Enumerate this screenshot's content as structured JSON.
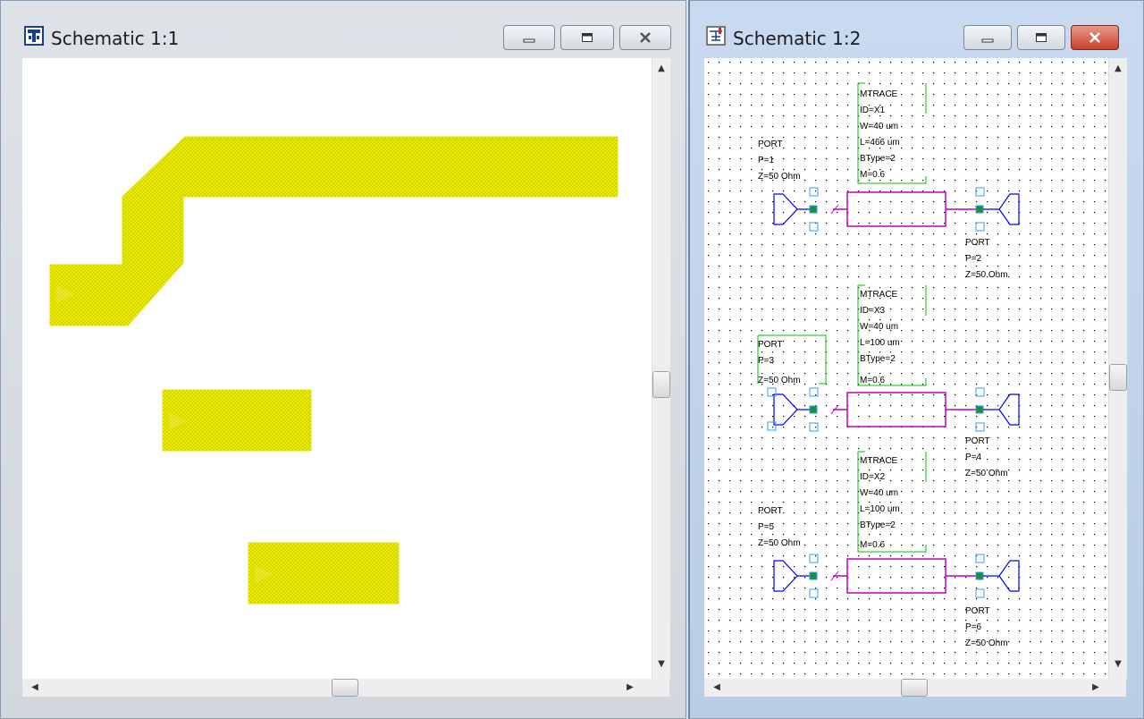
{
  "windows": [
    {
      "title": "Schematic 1:1",
      "icon": "schematic-layout-icon",
      "buttons": [
        "minimize",
        "maximize",
        "close"
      ]
    },
    {
      "title": "Schematic 1:2",
      "icon": "schematic-diagram-icon",
      "buttons": [
        "minimize",
        "maximize",
        "close"
      ],
      "components": {
        "mtrace1": {
          "name": "MTRACE",
          "id": "ID=X1",
          "w": "W=40 um",
          "l": "L=466 um",
          "btype": "BType=2",
          "m": "M=0.6"
        },
        "mtrace3": {
          "name": "MTRACE",
          "id": "ID=X3",
          "w": "W=40 um",
          "l": "L=100 um",
          "btype": "BType=2",
          "m": "M=0.6"
        },
        "mtrace2": {
          "name": "MTRACE",
          "id": "ID=X2",
          "w": "W=40 um",
          "l": "L=100 um",
          "btype": "BType=2",
          "m": "M=0.6"
        },
        "port1": {
          "name": "PORT",
          "p": "P=1",
          "z": "Z=50 Ohm"
        },
        "port2": {
          "name": "PORT",
          "p": "P=2",
          "z": "Z=50 Ohm"
        },
        "port3": {
          "name": "PORT",
          "p": "P=3",
          "z": "Z=50 Ohm"
        },
        "port4": {
          "name": "PORT",
          "p": "P=4",
          "z": "Z=50 Ohm"
        },
        "port5": {
          "name": "PORT",
          "p": "P=5",
          "z": "Z=50 Ohm"
        },
        "port6": {
          "name": "PORT",
          "p": "P=6",
          "z": "Z=50 Ohm"
        }
      }
    }
  ],
  "colors": {
    "trace_fill": "#f2f200",
    "wire": "#0000ff",
    "mtrace_body": "#c000c0",
    "selection": "#00c000",
    "handle": "#3399ff"
  }
}
